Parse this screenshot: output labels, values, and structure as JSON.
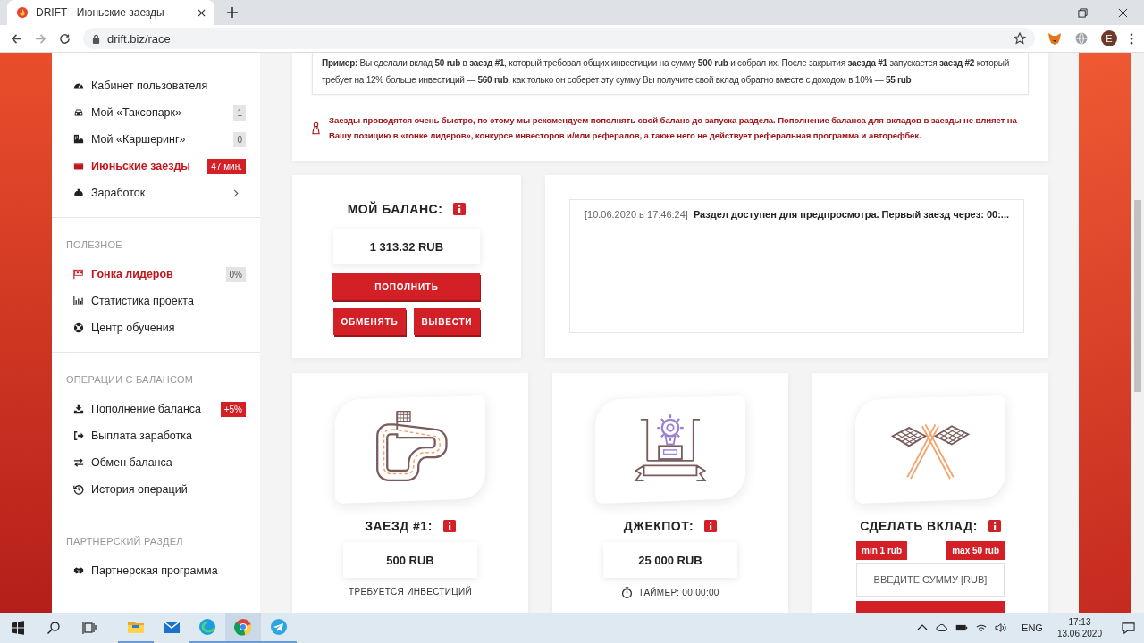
{
  "browser": {
    "tab_title": "DRIFT - Июньские заезды",
    "url": "drift.biz/race",
    "avatar": "E"
  },
  "sidebar": {
    "sections": [
      {
        "items": [
          {
            "label": "Кабинет пользователя",
            "selected": false
          },
          {
            "label": "Мой «Таксопарк»",
            "selected": false,
            "badge": {
              "text": "1",
              "highlighted": false
            }
          },
          {
            "label": "Мой «Каршеринг»",
            "selected": false,
            "badge": {
              "text": "0",
              "highlighted": false
            }
          },
          {
            "label": "Июньские заезды",
            "selected": true,
            "badge": {
              "text": "47 мин.",
              "highlighted": true
            }
          },
          {
            "label": "Заработок",
            "selected": false,
            "submenu": true
          }
        ]
      },
      {
        "title": "ПОЛЕЗНОЕ",
        "items": [
          {
            "label": "Гонка лидеров",
            "selected": true,
            "badge": {
              "text": "0%",
              "highlighted": false
            }
          },
          {
            "label": "Статистика проекта",
            "selected": false
          },
          {
            "label": "Центр обучения",
            "selected": false
          }
        ]
      },
      {
        "title": "ОПЕРАЦИИ С БАЛАНСОМ",
        "items": [
          {
            "label": "Пополнение баланса",
            "selected": false,
            "badge": {
              "text": "+5%",
              "highlighted": true
            }
          },
          {
            "label": "Выплата заработка",
            "selected": false
          },
          {
            "label": "Обмен баланса",
            "selected": false
          },
          {
            "label": "История операций",
            "selected": false
          }
        ]
      },
      {
        "title": "ПАРТНЕРСКИЙ РАЗДЕЛ",
        "items": [
          {
            "label": "Партнерская программа",
            "selected": false
          }
        ]
      }
    ]
  },
  "example": "**Пример:** Вы сделали вклад **50 rub** в **заезд #1**, который требовал общих инвестиции на сумму **500 rub** и собрал их. После закрытия **заезда #1** запускается **заезд #2** который требует на 12% больше инвестиций — **560 rub**, как только он соберет эту сумму Вы получите свой вклад обратно вместе с доходом в 10% — **55 rub**",
  "warning": "Заезды проводятся очень быстро, по этому мы рекомендуем пополнять свой баланс до запуска раздела. Пополнение баланса для вкладов в заезды не влияет на Вашу позицию в «гонке лидеров», конкурсе инвесторов и/или рефералов, а также него не действует реферальная программа и авторефбек.",
  "balance": {
    "title": "МОЙ БАЛАНС:",
    "amount": "1 313.32 RUB",
    "buttons": [
      "ПОПОЛНИТЬ",
      "ОБМЕНЯТЬ",
      "ВЫВЕСТИ"
    ]
  },
  "log": [
    {
      "time": "[10.06.2020 в 17:46:24]",
      "message": "Раздел доступен для предпросмотра. Первый заезд через: 00:..."
    }
  ],
  "cards": [
    {
      "kind": "race",
      "title": "ЗАЕЗД #1:",
      "value": "500 RUB",
      "note": "ТРЕБУЕТСЯ ИНВЕСТИЦИЙ"
    },
    {
      "kind": "jackpot",
      "title": "ДЖЕКПОТ:",
      "value": "25 000 RUB",
      "note": "ТАЙМЕР: 00:00:00"
    },
    {
      "kind": "deposit",
      "title": "СДЕЛАТЬ ВКЛАД:",
      "min": "min 1 rub",
      "max": "max 50 rub",
      "placeholder": "ВВЕДИТЕ СУММУ [RUB]"
    }
  ],
  "taskbar": {
    "apps": [
      {
        "running": true,
        "selected": false
      },
      {
        "running": false,
        "selected": false
      },
      {
        "running": true,
        "selected": false
      },
      {
        "running": true,
        "selected": true
      },
      {
        "running": true,
        "selected": false
      }
    ],
    "lang": "ENG",
    "time": "17:13",
    "date": "13.06.2020"
  }
}
